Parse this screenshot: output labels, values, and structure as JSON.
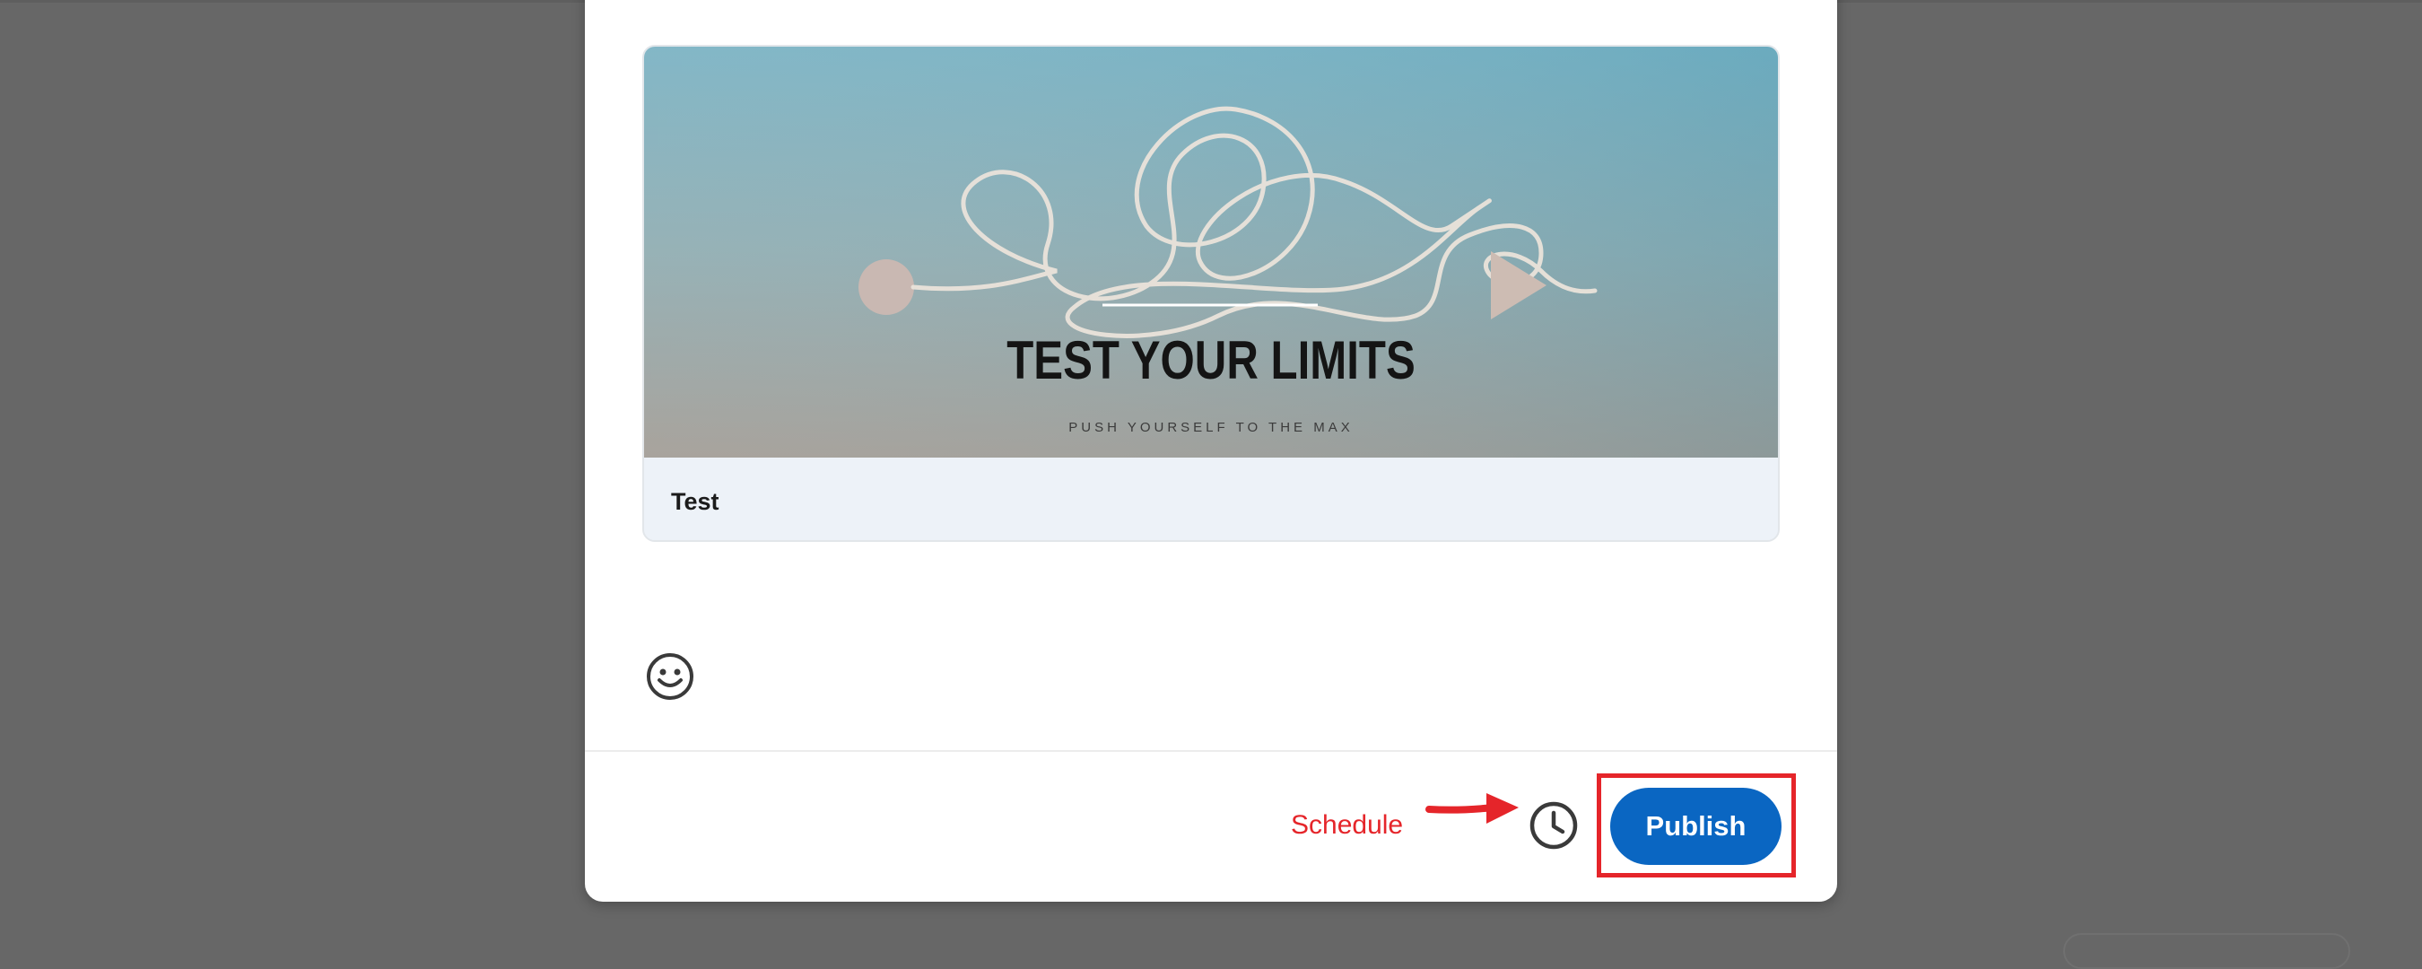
{
  "preview_card": {
    "image_headline": "TEST YOUR LIMITS",
    "image_subline": "PUSH YOURSELF TO THE MAX",
    "title": "Test"
  },
  "composer": {
    "emoji_icon": "smiley-face-icon"
  },
  "footer": {
    "schedule_annotation": "Schedule",
    "schedule_icon": "clock-icon",
    "publish_label": "Publish"
  },
  "colors": {
    "overlay": "#676767",
    "publish_button": "#0a66c2",
    "annotation_red": "#e5252a",
    "card_footer_bg": "#edf2f8"
  }
}
